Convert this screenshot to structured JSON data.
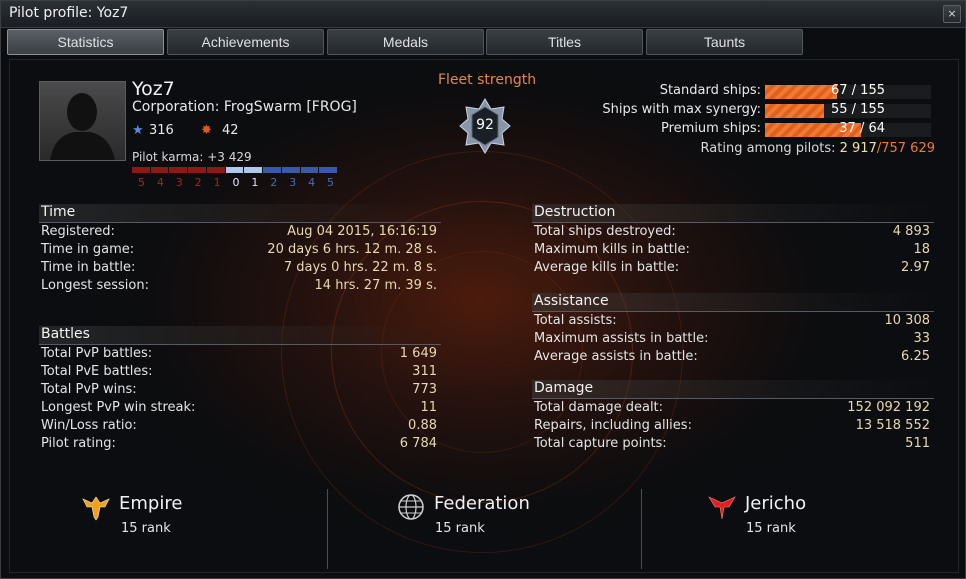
{
  "window": {
    "title": "Pilot profile: Yoz7",
    "close_glyph": "×"
  },
  "tabs": [
    {
      "label": "Statistics",
      "active": true
    },
    {
      "label": "Achievements",
      "active": false
    },
    {
      "label": "Medals",
      "active": false
    },
    {
      "label": "Titles",
      "active": false
    },
    {
      "label": "Taunts",
      "active": false
    }
  ],
  "pilot": {
    "name": "Yoz7",
    "corporation": "Corporation: FrogSwarm [FROG]",
    "stars": "316",
    "kills_badge": "42",
    "karma_label": "Pilot karma: +3 429",
    "karma_scale": [
      "5",
      "4",
      "3",
      "2",
      "1",
      "0",
      "1",
      "2",
      "3",
      "4",
      "5"
    ]
  },
  "fleet": {
    "title": "Fleet strength",
    "value": "92"
  },
  "ships": [
    {
      "label": "Standard ships:",
      "value": "67 / 155",
      "fraction": 0.432
    },
    {
      "label": "Ships with max synergy:",
      "value": "55 / 155",
      "fraction": 0.355
    },
    {
      "label": "Premium ships:",
      "value": "37 / 64",
      "fraction": 0.578
    }
  ],
  "rating": {
    "label": "Rating among pilots:",
    "rank": "2 917",
    "total": "757 629"
  },
  "sections": {
    "time": {
      "title": "Time",
      "rows": [
        {
          "k": "Registered:",
          "v": "Aug 04 2015, 16:16:19"
        },
        {
          "k": "Time in game:",
          "v": "20 days 6 hrs. 12 m. 28 s."
        },
        {
          "k": "Time in battle:",
          "v": "7 days 0 hrs. 22 m. 8 s."
        },
        {
          "k": "Longest session:",
          "v": "14 hrs. 27 m. 39 s."
        }
      ]
    },
    "battles": {
      "title": "Battles",
      "rows": [
        {
          "k": "Total PvP battles:",
          "v": "1 649"
        },
        {
          "k": "Total PvE battles:",
          "v": "311"
        },
        {
          "k": "Total PvP wins:",
          "v": "773"
        },
        {
          "k": "Longest PvP win streak:",
          "v": "11"
        },
        {
          "k": "Win/Loss ratio:",
          "v": "0.88"
        },
        {
          "k": "Pilot rating:",
          "v": "6 784"
        }
      ]
    },
    "destruction": {
      "title": "Destruction",
      "rows": [
        {
          "k": "Total ships destroyed:",
          "v": "4 893"
        },
        {
          "k": "Maximum kills in battle:",
          "v": "18"
        },
        {
          "k": "Average kills in battle:",
          "v": "2.97"
        }
      ]
    },
    "assistance": {
      "title": "Assistance",
      "rows": [
        {
          "k": "Total assists:",
          "v": "10 308"
        },
        {
          "k": "Maximum assists in battle:",
          "v": "33"
        },
        {
          "k": "Average assists in battle:",
          "v": "6.25"
        }
      ]
    },
    "damage": {
      "title": "Damage",
      "rows": [
        {
          "k": "Total damage dealt:",
          "v": "152 092 192"
        },
        {
          "k": "Repairs, including allies:",
          "v": "13 518 552"
        },
        {
          "k": "Total capture points:",
          "v": "511"
        }
      ]
    }
  },
  "factions": [
    {
      "name": "Empire",
      "rank": "15 rank",
      "icon": "empire-eagle-icon",
      "color": "#f0a020"
    },
    {
      "name": "Federation",
      "rank": "15 rank",
      "icon": "federation-globe-icon",
      "color": "#c8c8c8"
    },
    {
      "name": "Jericho",
      "rank": "15 rank",
      "icon": "jericho-emblem-icon",
      "color": "#e02020"
    }
  ],
  "colors": {
    "accent": "#f07a30",
    "karma_neg": "#8a1a14",
    "karma_pos": "#3a5aa8",
    "karma_zero": "#b0c8f0"
  }
}
